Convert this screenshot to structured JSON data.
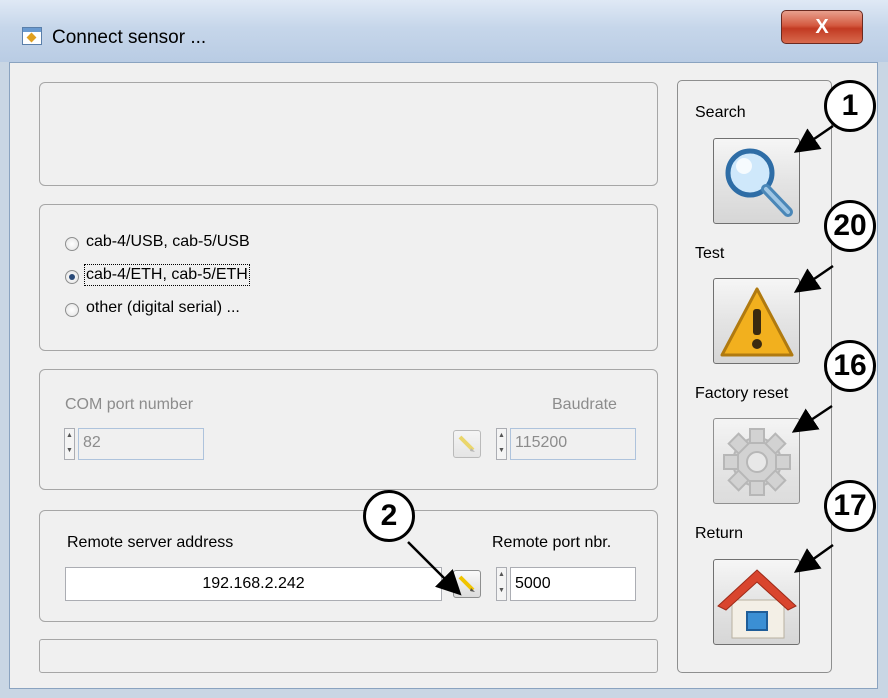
{
  "window": {
    "title": "Connect sensor ...",
    "close_label": "X"
  },
  "info_box": {
    "text": ""
  },
  "connection_type": {
    "options": [
      {
        "label": "cab-4/USB, cab-5/USB",
        "selected": false
      },
      {
        "label": "cab-4/ETH, cab-5/ETH",
        "selected": true
      },
      {
        "label": "other (digital serial) ...",
        "selected": false
      }
    ]
  },
  "com_group": {
    "com_label": "COM port number",
    "com_value": "82",
    "baud_label": "Baudrate",
    "baud_value": "115200"
  },
  "remote_group": {
    "address_label": "Remote server address",
    "address_value": "192.168.2.242",
    "port_label": "Remote port nbr.",
    "port_value": "5000"
  },
  "status_bar": {
    "text": ""
  },
  "sidebar": {
    "search_label": "Search",
    "test_label": "Test",
    "factory_reset_label": "Factory reset",
    "return_label": "Return"
  },
  "callouts": {
    "search": "1",
    "test": "20",
    "factory_reset": "16",
    "return": "17",
    "edit": "2"
  },
  "colors": {
    "close_button": "#c23a22",
    "house_roof": "#d9452e",
    "warning": "#f2b01e"
  }
}
